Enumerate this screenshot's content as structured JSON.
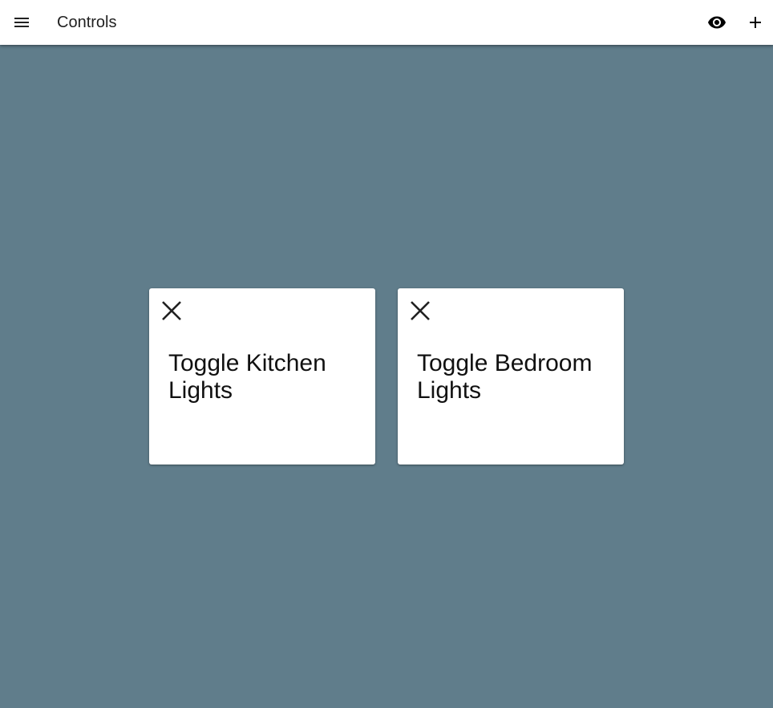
{
  "header": {
    "title": "Controls",
    "menu_icon": "menu-icon",
    "preview_icon": "eye-icon",
    "add_icon": "plus-icon"
  },
  "cards": [
    {
      "label": "Toggle Kitchen Lights",
      "close_icon": "close-icon"
    },
    {
      "label": "Toggle Bedroom Lights",
      "close_icon": "close-icon"
    }
  ],
  "colors": {
    "background": "#607d8b",
    "app_bar": "#ffffff",
    "card": "#ffffff",
    "text": "#111111"
  }
}
